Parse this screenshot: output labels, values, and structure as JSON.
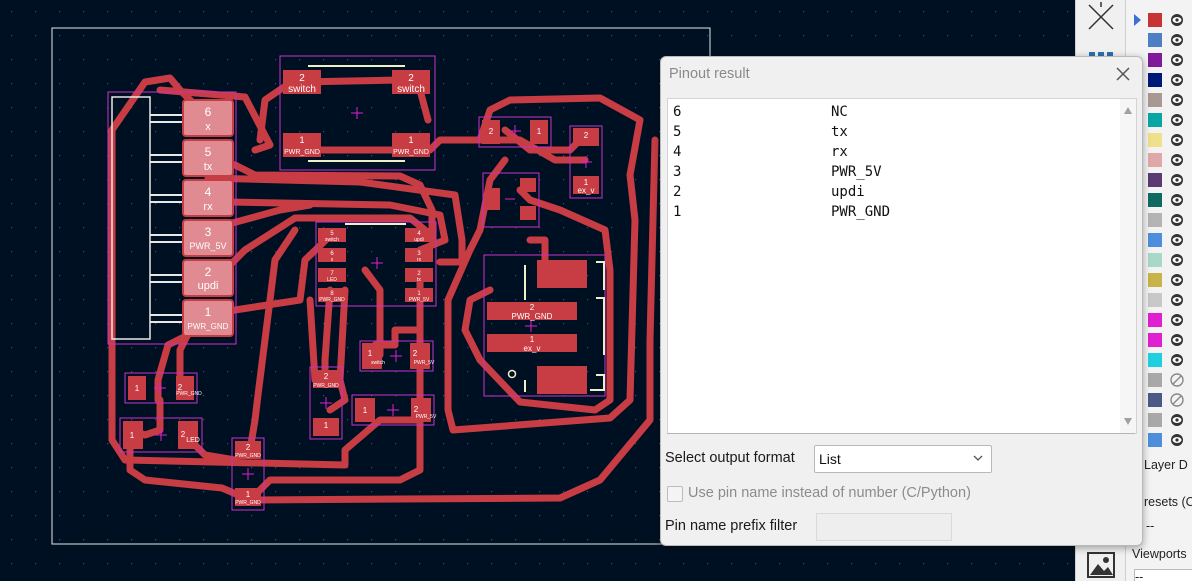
{
  "dialog": {
    "title": "Pinout result",
    "pins": [
      {
        "num": "6",
        "name": "NC"
      },
      {
        "num": "5",
        "name": "tx"
      },
      {
        "num": "4",
        "name": "rx"
      },
      {
        "num": "3",
        "name": "PWR_5V"
      },
      {
        "num": "2",
        "name": "updi"
      },
      {
        "num": "1",
        "name": "PWR_GND"
      }
    ],
    "format_label": "Select output format",
    "format_value": "List",
    "checkbox_label": "Use pin name instead of number (C/Python)",
    "prefix_label": "Pin name prefix filter"
  },
  "pcb": {
    "connector_pins": [
      {
        "num": "6",
        "name": "x"
      },
      {
        "num": "5",
        "name": "tx"
      },
      {
        "num": "4",
        "name": "rx"
      },
      {
        "num": "3",
        "name": "PWR_5V"
      },
      {
        "num": "2",
        "name": "updi"
      },
      {
        "num": "1",
        "name": "PWR_GND"
      }
    ],
    "switch_top": {
      "pin2": "2",
      "pin2_net": "switch",
      "pin1": "1",
      "pin1_net": "PWR_GND"
    },
    "ic_left": [
      {
        "num": "5",
        "name": "switch"
      },
      {
        "num": "6",
        "name": "x"
      },
      {
        "num": "7",
        "name": "LED"
      },
      {
        "num": "8",
        "name": "PWR_GND"
      }
    ],
    "ic_right": [
      {
        "num": "4",
        "name": "updi"
      },
      {
        "num": "3",
        "name": "rx"
      },
      {
        "num": "2",
        "name": "tx"
      },
      {
        "num": "1",
        "name": "PWR_5V"
      }
    ],
    "jack": {
      "pin2": "2",
      "pin2_net": "PWR_GND",
      "pin1": "1",
      "pin1_net": "ex_v"
    },
    "cap_right": {
      "pin2": "2",
      "pin1": "1",
      "net": "ex_v"
    },
    "res_top": {
      "pin1": "1",
      "pin2": "2",
      "net": "PWR_5V"
    },
    "led_left": {
      "pin1": "1",
      "pin2": "2",
      "net": "LED"
    },
    "res_left": {
      "pin1": "1",
      "pin2": "2",
      "net": "PWR_GND"
    },
    "sw_small": {
      "pin1": "1",
      "pin1_net": "switch",
      "pin2": "2",
      "pin2_net": "PWR_5V"
    },
    "cap_mid": {
      "pin2": "2",
      "pin2_net": "PWR_GND",
      "pin1": "1"
    },
    "res_mid": {
      "pin1": "1",
      "pin2": "2",
      "pin2_net": "PWR_5V"
    },
    "cap_bottom": {
      "pin2": "2",
      "pin2_net": "PWR_GND",
      "pin1": "1",
      "pin1_net": "PWR_GND"
    }
  },
  "layers": {
    "colors": [
      "#c83434",
      "#4d7fc4",
      "#7f1a9a",
      "#001a7a",
      "#a89a92",
      "#0aa6a6",
      "#f0e08c",
      "#e0a8a8",
      "#5c3a74",
      "#0f6a62",
      "#b4b4b4",
      "#4d8fdc",
      "#a8d8c8",
      "#c8b44a",
      "#c8c8c8",
      "#e020d0",
      "#e020d0",
      "#20d0e0",
      "#a8a8a8",
      "#4a5a84",
      "#a8a8a8",
      "#4d8fdc"
    ],
    "footer_label": "Layer D",
    "presets_label": "resets (Ct",
    "presets_value": "--",
    "viewports_label": "Viewports",
    "viewports_value": "--"
  },
  "colors": {
    "copper": "#c83c44",
    "pad": "#e08a92",
    "silk": "#f0f0c8",
    "courtyard": "#c832c8",
    "background": "#001023"
  }
}
